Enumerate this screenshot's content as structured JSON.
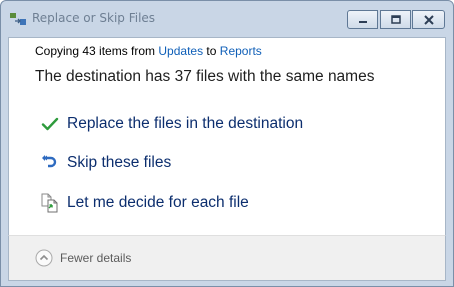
{
  "window": {
    "title": "Replace or Skip Files"
  },
  "dialog": {
    "copying_prefix": "Copying 43 items from ",
    "source": "Updates",
    "copying_mid": " to ",
    "destination": "Reports",
    "headline": "The destination has 37 files with the same names",
    "options": [
      {
        "label": "Replace the files in the destination",
        "icon": "checkmark-icon"
      },
      {
        "label": "Skip these files",
        "icon": "skip-arrow-icon"
      },
      {
        "label": "Let me decide for each file",
        "icon": "compare-files-icon"
      }
    ],
    "details_toggle": "Fewer details"
  },
  "colors": {
    "accent": "#0f5fb8",
    "check": "#2e9b3c",
    "title_text": "#6e7f93"
  }
}
